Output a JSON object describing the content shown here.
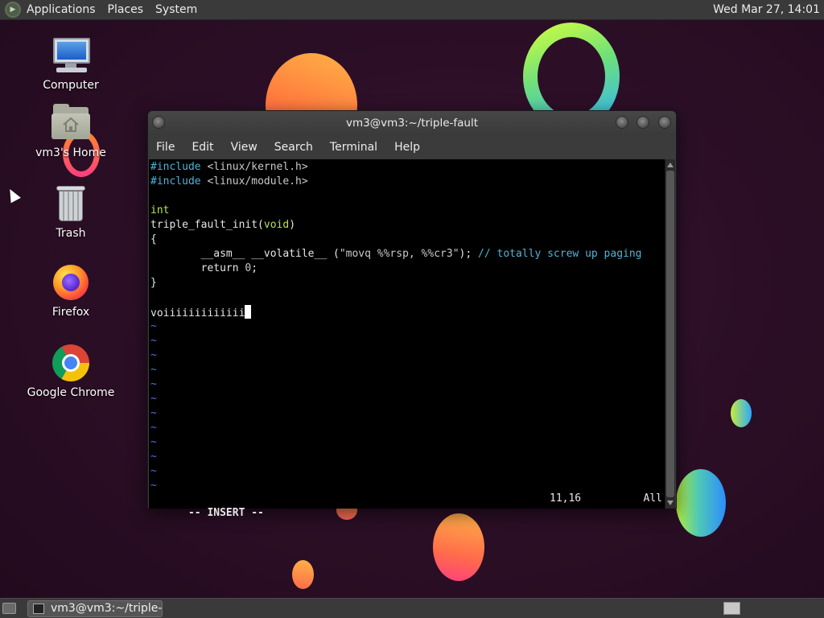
{
  "top_panel": {
    "menus": [
      "Applications",
      "Places",
      "System"
    ],
    "clock": "Wed Mar 27, 14:01"
  },
  "desktop": {
    "icons": [
      {
        "label": "Computer",
        "icon": "computer-icon"
      },
      {
        "label": "vm3's Home",
        "icon": "home-folder-icon"
      },
      {
        "label": "Trash",
        "icon": "trash-icon"
      },
      {
        "label": "Firefox",
        "icon": "firefox-icon"
      },
      {
        "label": "Google Chrome",
        "icon": "chrome-icon"
      }
    ]
  },
  "terminal": {
    "title": "vm3@vm3:~/triple-fault",
    "menu": [
      "File",
      "Edit",
      "View",
      "Search",
      "Terminal",
      "Help"
    ],
    "code": {
      "line1_directive": "#include",
      "line1_file": " <linux/kernel.h>",
      "line2_directive": "#include",
      "line2_file": " <linux/module.h>",
      "line4": "int",
      "line5_name": "triple_fault_init(",
      "line5_param": "void",
      "line5_close": ")",
      "line6": "{",
      "line7_prefix": "        __asm__ __volatile__ (",
      "line7_string": "\"movq %%rsp, %%cr3\"",
      "line7_suffix": "); ",
      "line7_comment": "// totally screw up paging",
      "line8_prefix": "        return ",
      "line8_value": "0",
      "line8_suffix": ";",
      "line9": "}",
      "line11": "voiiiiiiiiiiiii",
      "tilde": "~"
    },
    "status": {
      "mode": "-- INSERT --",
      "position": "11,16",
      "scroll": "All"
    }
  },
  "taskbar": {
    "task_label": "vm3@vm3:~/triple-..."
  },
  "colors": {
    "desktop_bg": "#2c0f27",
    "panel_bg": "#3a3a3a",
    "terminal_bg": "#000000",
    "preproc": "#4fb3d9",
    "type": "#b8e05a",
    "tilde": "#5a6fd8"
  }
}
